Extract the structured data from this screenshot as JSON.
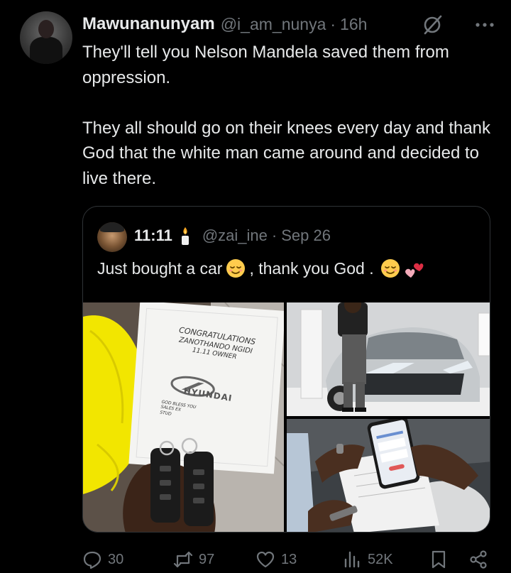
{
  "tweet": {
    "author_name": "Mawunanunyam",
    "handle": "@i_am_nunya",
    "separator": "·",
    "time": "16h",
    "paragraphs": [
      "They'll tell you Nelson Mandela saved them from oppression.",
      "They all should go on their knees every day and thank God that the white man came around and decided to live there."
    ],
    "icons": {
      "grok": "grok-icon",
      "more": "more-options-icon"
    }
  },
  "quoted": {
    "author_name": "11:11",
    "badge_icon": "candle-icon",
    "handle": "@zai_ine",
    "separator": "·",
    "time": "Sep 26",
    "text_part1": "Just bought a car",
    "text_part2": ", thank you God .",
    "emojis": [
      "relieved-face",
      "relieved-face",
      "two-hearts"
    ],
    "photo_text": {
      "line1": "CONGRATULATIONS",
      "line2": "ZANOTHANDO NGIDI",
      "line3": "11.11 OWNER",
      "brand": "HYUNDAI",
      "footer1": "GOD BLESS YOU",
      "footer2": "SALES EX",
      "footer3": "STUD"
    }
  },
  "actions": {
    "replies": "30",
    "reposts": "97",
    "likes": "13",
    "views": "52K"
  },
  "colors": {
    "background": "#000000",
    "text": "#e7e9ea",
    "muted": "#71767b",
    "border": "#2f3336"
  }
}
